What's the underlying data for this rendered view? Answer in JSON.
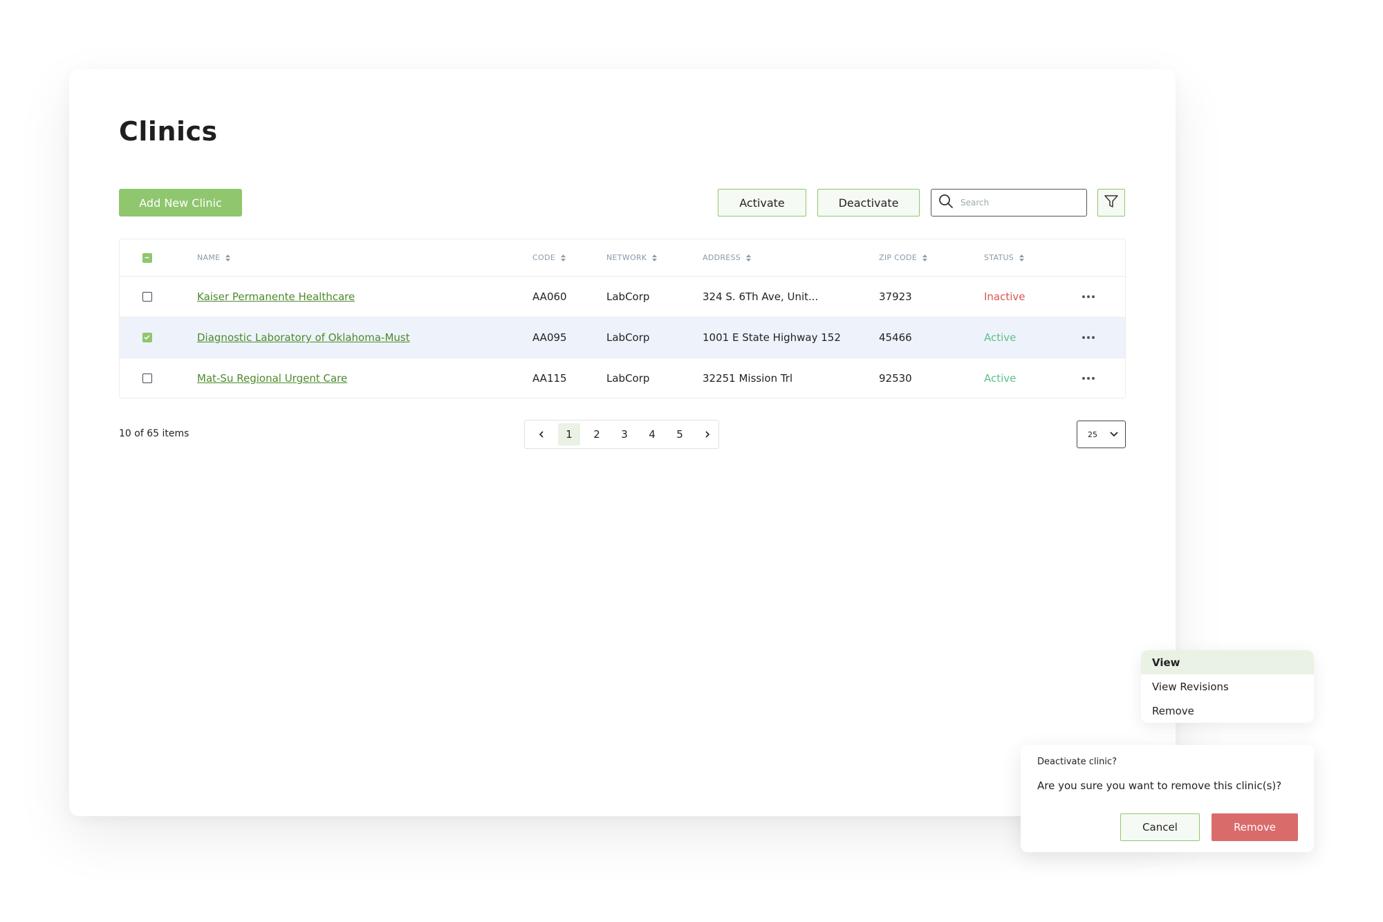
{
  "page": {
    "title": "Clinics"
  },
  "toolbar": {
    "add_label": "Add New Clinic",
    "activate_label": "Activate",
    "deactivate_label": "Deactivate",
    "search_placeholder": "Search"
  },
  "table": {
    "columns": [
      "NAME",
      "CODE",
      "NETWORK",
      "ADDRESS",
      "ZIP CODE",
      "STATUS"
    ],
    "rows": [
      {
        "name": "Kaiser Permanente Healthcare",
        "code": "AA060",
        "network": "LabCorp",
        "address": "324 S. 6Th Ave, Unit...",
        "zip": "37923",
        "status": "Inactive",
        "checked": false
      },
      {
        "name": "Diagnostic Laboratory of Oklahoma-Must",
        "code": "AA095",
        "network": "LabCorp",
        "address": "1001 E State Highway 152",
        "zip": "45466",
        "status": "Active",
        "checked": true
      },
      {
        "name": "Mat-Su Regional Urgent Care ",
        "code": "AA115",
        "network": "LabCorp",
        "address": "32251 Mission Trl",
        "zip": "92530",
        "status": "Active",
        "checked": false
      }
    ]
  },
  "footer": {
    "items_count": "10 of 65 items",
    "pages": [
      "1",
      "2",
      "3",
      "4",
      "5"
    ],
    "current_page": "1",
    "page_size": "25"
  },
  "context_menu": {
    "items": [
      "View",
      "View Revisions",
      "Remove"
    ]
  },
  "dialog": {
    "title": "Deactivate clinic?",
    "message": "Are you sure you want to remove this clinic(s)?",
    "cancel_label": "Cancel",
    "confirm_label": "Remove"
  },
  "colors": {
    "accent": "#8fc66e",
    "link": "#4b8a2a",
    "inactive": "#d9534f",
    "active": "#5cc08a",
    "danger": "#d96b6b"
  }
}
